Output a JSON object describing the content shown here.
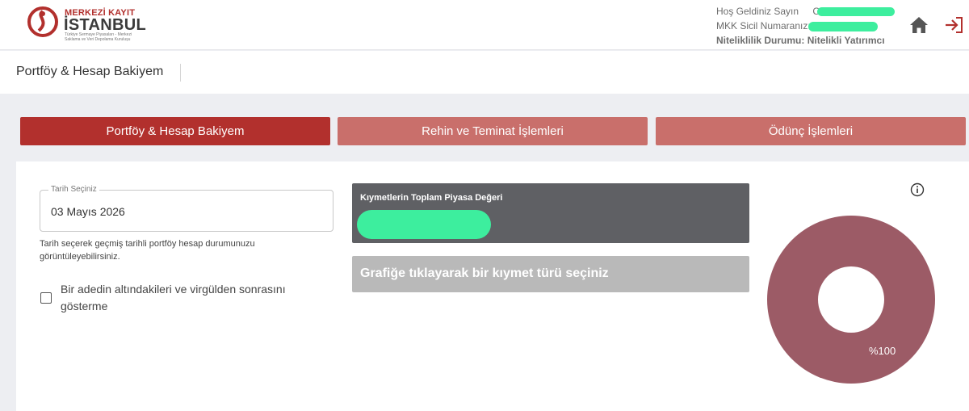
{
  "header": {
    "logo_title1": "MERKEZİ KAYIT",
    "logo_title2": "İSTANBUL",
    "logo_sub": "Türkiye Sermaye Piyasaları - Merkezi Saklama ve Veri Depolama Kuruluşu",
    "welcome_label": "Hoş Geldiniz Sayın",
    "welcome_partial": "C",
    "sicil_label": "MKK Sicil Numaranız:",
    "status_label": "Niteliklilik Durumu:",
    "status_value": "Nitelikli Yatırımcı",
    "mask_color": "#3dee9e",
    "home_icon": "home-icon",
    "logout_icon": "logout-icon"
  },
  "page": {
    "title": "Portföy & Hesap Bakiyem"
  },
  "tabs": [
    {
      "label": "Portföy & Hesap Bakiyem",
      "active": true
    },
    {
      "label": "Rehin ve Teminat İşlemleri",
      "active": false
    },
    {
      "label": "Ödünç İşlemleri",
      "active": false
    }
  ],
  "form": {
    "date_legend": "Tarih Seçiniz",
    "date_value": "03 Mayıs 2026",
    "help_text": "Tarih seçerek geçmiş tarihli portföy hesap durumunuzu görüntüleyebilirsiniz.",
    "checkbox_label": "Bir adedin altındakileri ve virgülden sonrasını gösterme",
    "checkbox_checked": false
  },
  "summary": {
    "value_title": "Kıymetlerin Toplam Piyasa Değeri",
    "select_prompt": "Grafiğe tıklayarak bir kıymet türü seçiniz"
  },
  "colors": {
    "brand_red": "#b2302d",
    "tab_inactive": "#c96f6b",
    "donut": "#9c5b66"
  },
  "chart_data": {
    "type": "pie",
    "categories": [
      ""
    ],
    "values": [
      100
    ],
    "data_labels": [
      "%100"
    ]
  }
}
